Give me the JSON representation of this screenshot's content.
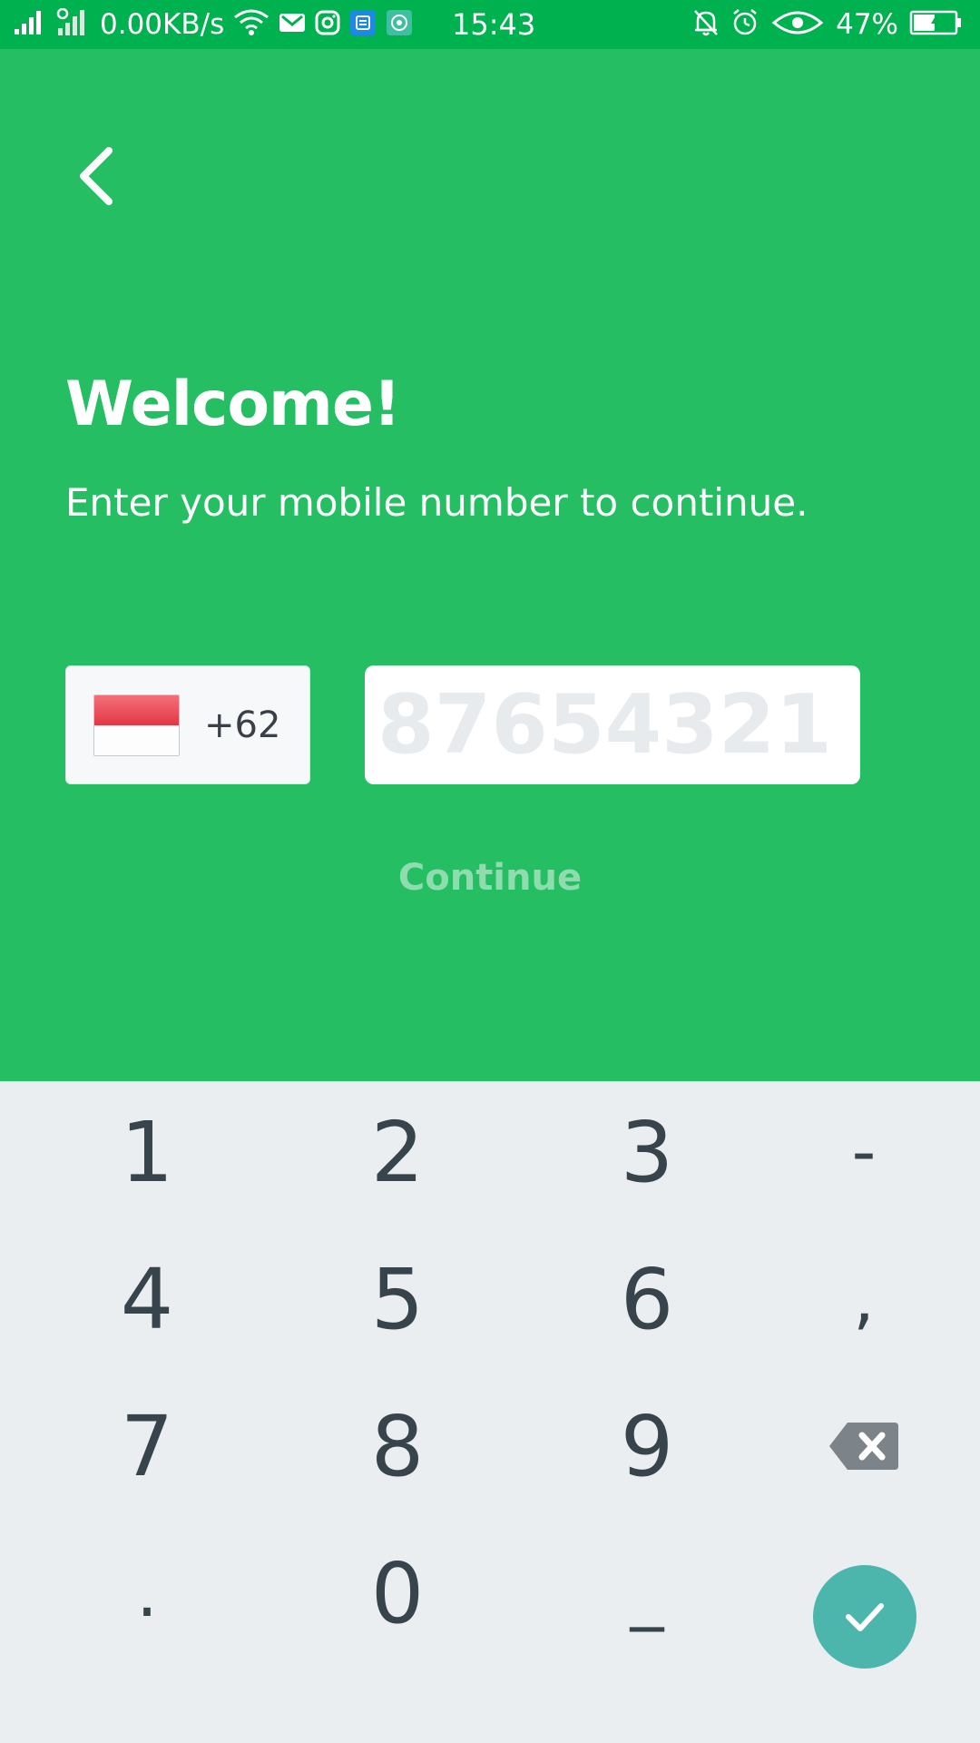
{
  "status_bar": {
    "network_speed": "0.00KB/s",
    "time": "15:43",
    "battery": "47%"
  },
  "screen": {
    "title": "Welcome!",
    "subtitle": "Enter your mobile number to continue.",
    "country_code": "+62",
    "phone_placeholder": "87654321",
    "phone_value": "",
    "continue_label": "Continue"
  },
  "keypad": {
    "keys": [
      "1",
      "2",
      "3",
      "-",
      "4",
      "5",
      "6",
      ",",
      "7",
      "8",
      "9",
      ".",
      "0",
      "_"
    ]
  },
  "colors": {
    "status_bar": "#00b14f",
    "header": "#25be63",
    "keypad_bg": "#ebeef1",
    "done_key": "#4db6ac",
    "key_text": "#37444c"
  },
  "icons": [
    "back-arrow-icon",
    "flag-indonesia-icon",
    "backspace-icon",
    "check-icon"
  ]
}
